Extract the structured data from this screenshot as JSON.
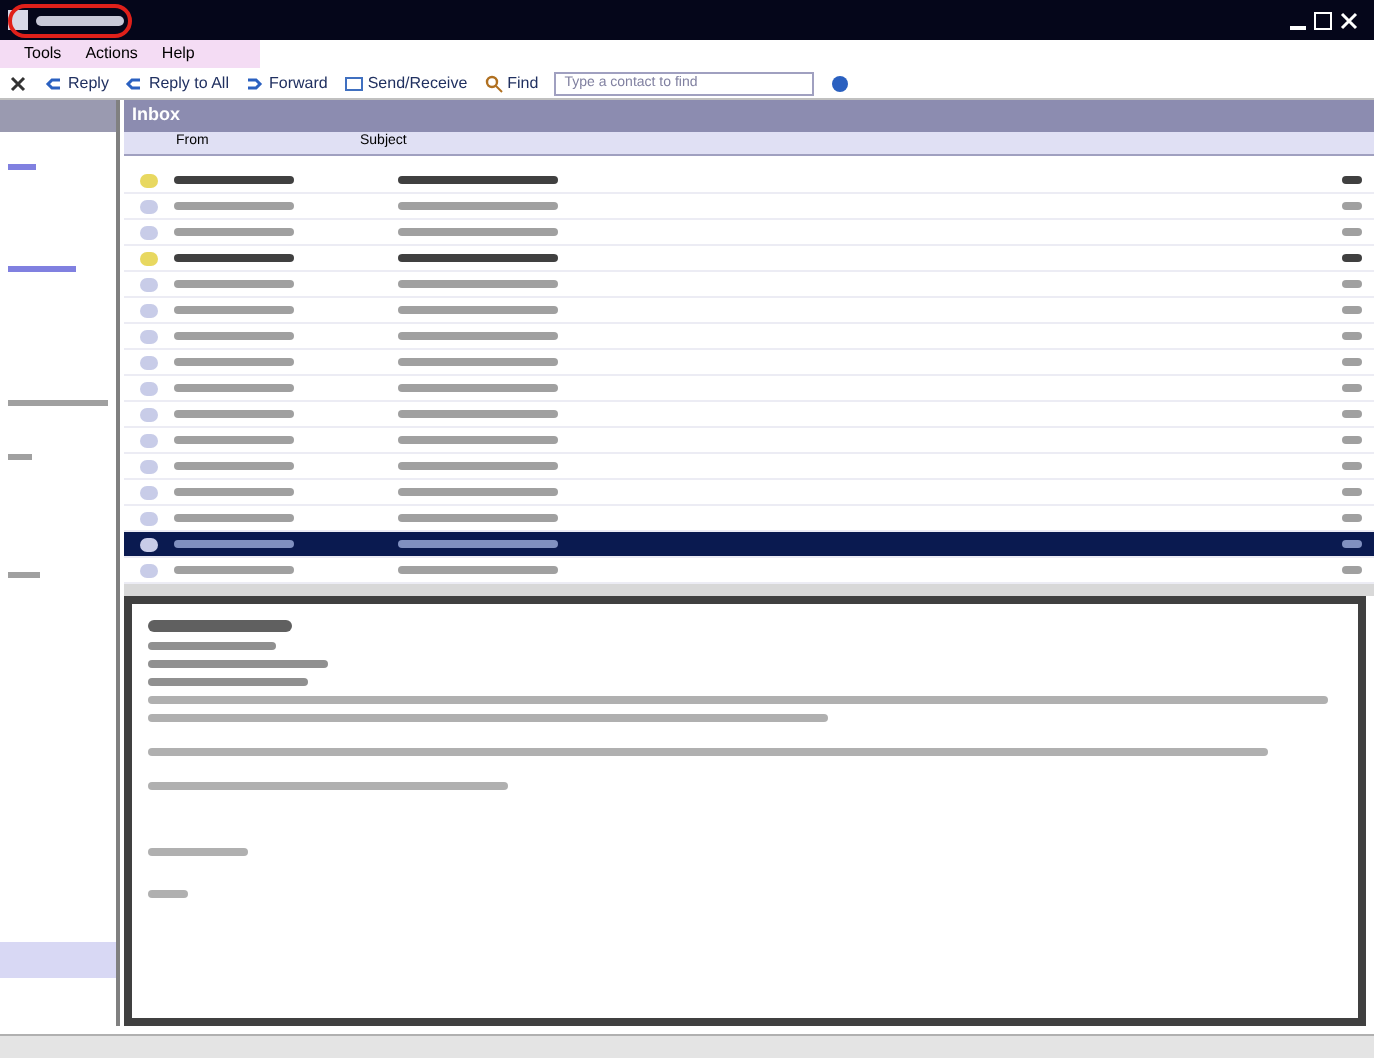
{
  "menu": [
    "Tools",
    "Actions",
    "Help"
  ],
  "toolbar": [
    {
      "kind": "close"
    },
    {
      "kind": "reply",
      "label": "Reply"
    },
    {
      "kind": "reply",
      "label": "Reply to All"
    },
    {
      "kind": "forward",
      "label": "Forward"
    },
    {
      "kind": "send",
      "label": "Send/Receive"
    },
    {
      "kind": "find",
      "label": "Find"
    }
  ],
  "contact_search": {
    "placeholder": "Type a contact to find"
  },
  "folder": {
    "title": "Inbox",
    "columns": [
      "From",
      "Subject"
    ]
  },
  "messages": [
    {
      "unread": true,
      "selected": false
    },
    {
      "unread": false,
      "selected": false
    },
    {
      "unread": false,
      "selected": false
    },
    {
      "unread": true,
      "selected": false
    },
    {
      "unread": false,
      "selected": false
    },
    {
      "unread": false,
      "selected": false
    },
    {
      "unread": false,
      "selected": false
    },
    {
      "unread": false,
      "selected": false
    },
    {
      "unread": false,
      "selected": false
    },
    {
      "unread": false,
      "selected": false
    },
    {
      "unread": false,
      "selected": false
    },
    {
      "unread": false,
      "selected": false
    },
    {
      "unread": false,
      "selected": false
    },
    {
      "unread": false,
      "selected": false
    },
    {
      "unread": false,
      "selected": true
    },
    {
      "unread": false,
      "selected": false
    }
  ]
}
